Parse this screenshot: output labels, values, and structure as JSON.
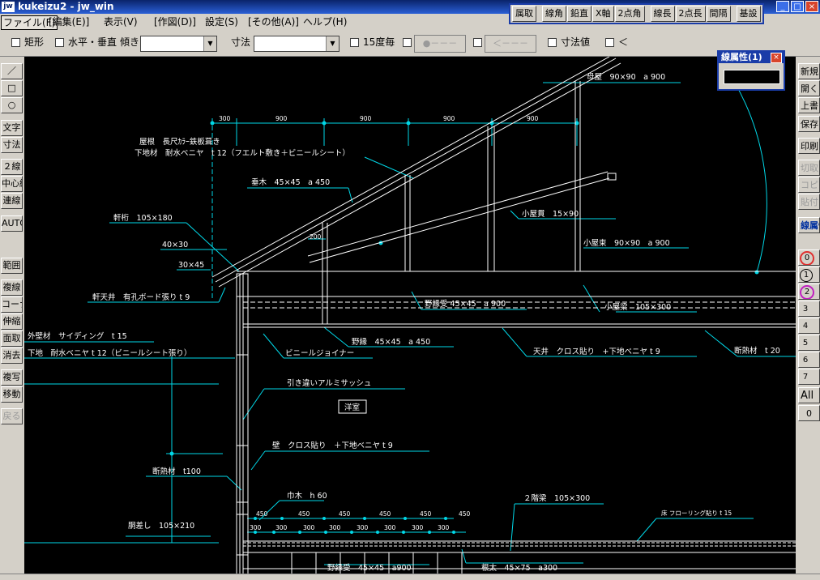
{
  "window": {
    "title": "kukeizu2 - jw_win",
    "icon": "jw-icon"
  },
  "menu": [
    "ファイル(F)",
    "[編集(E)]",
    "表示(V)",
    "[作図(D)]",
    "設定(S)",
    "[その他(A)]",
    "ヘルプ(H)"
  ],
  "command_buttons": [
    "属取",
    "線角",
    "鉛直",
    "X軸",
    "2点角",
    "線長",
    "2点長",
    "間隔",
    "基設"
  ],
  "options": {
    "rect": "矩形",
    "hv": "水平・垂直",
    "tilt": "傾き",
    "dim": "寸法",
    "deg15": "15度毎",
    "btn1": "●－－－",
    "btn2": "＜－－－",
    "dimval": "寸法値",
    "lt": "＜"
  },
  "left_tools": [
    "／",
    "□",
    "○",
    "文字",
    "寸法",
    "２線",
    "中心線",
    "連線",
    "AUTO",
    "範囲",
    "複線",
    "コーナー",
    "伸縮",
    "面取",
    "消去",
    "複写",
    "移動",
    "戻る"
  ],
  "right_tools": [
    "新規",
    "開く",
    "上書",
    "保存",
    "印刷",
    "切取",
    "コピー",
    "貼付",
    "線属性"
  ],
  "layers": [
    "0",
    "1",
    "2",
    "3",
    "4",
    "5",
    "6",
    "7"
  ],
  "layer_extra": [
    "All",
    "0"
  ],
  "line_attr_title": "線属性(1)",
  "drawing": {
    "dims_top": [
      "300",
      "900",
      "900",
      "900",
      "900"
    ],
    "dims_450": [
      "450",
      "450",
      "450",
      "450",
      "450",
      "450"
    ],
    "dims_300": [
      "300",
      "300",
      "300",
      "300",
      "300",
      "300",
      "300",
      "300"
    ],
    "dim_200": "200",
    "labels": {
      "moya": "母屋　90×90　a 900",
      "roof1": "屋根　長尺ｶﾗｰ鉄板葺き",
      "roof2": "下地材　耐水ベニヤ　t 12（フエルト敷き＋ビニールシート）",
      "taruki": "垂木　45×45　a 450",
      "nokigeta": "軒桁　105×180",
      "d4030": "40×30",
      "d3045": "30×45",
      "nokiten": "軒天井　有孔ボード張り t 9",
      "gaiheki": "外壁材　サイディング　t 15",
      "shitaji": "下地　耐水ベニヤ t 12（ビニールシート張り）",
      "koyanuki": "小屋貫　15×90",
      "koyazuka": "小屋束　90×90　a 900",
      "noenuke": "野縁受 45×45　a 900",
      "koyabari": "小屋梁　105×300",
      "noen": "野縁　45×45　a 450",
      "vinyl": "ビニールジョイナー",
      "tenjo": "天井　クロス貼り　+下地ベニヤ t 9",
      "danbo1": "断熱材　t 20",
      "sash": "引き違いアルミサッシュ",
      "room": "洋室",
      "wall": "壁　クロス貼り　＋下地ベニヤ t 9",
      "danbo2": "断熱材　t100",
      "habaki": "巾木　h 60",
      "beam2": "２階梁　105×300",
      "floor": "床 フローリング貼り t 15",
      "dosashi": "胴差し　105×210",
      "noenuke2": "野縁受　45×45　a900",
      "neda": "根太　45×75　a300"
    }
  }
}
